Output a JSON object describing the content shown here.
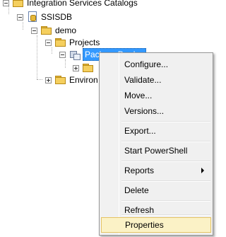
{
  "tree": {
    "root": "Integration Services Catalogs",
    "catalog": "SSISDB",
    "folder": "demo",
    "projects": "Projects",
    "project": "PackageDeploy",
    "environments": "Environ"
  },
  "menu": {
    "items": [
      "Configure...",
      "Validate...",
      "Move...",
      "Versions...",
      "Export...",
      "Start PowerShell",
      "Reports",
      "Delete",
      "Refresh",
      "Properties"
    ],
    "highlighted": "Properties"
  }
}
